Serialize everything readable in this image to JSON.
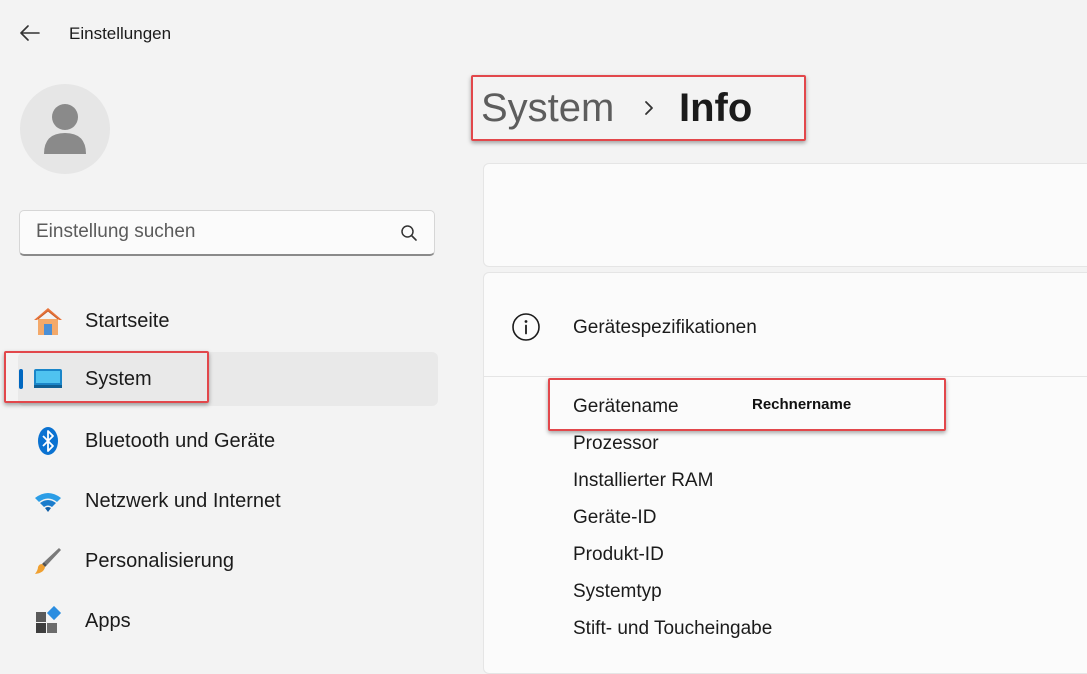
{
  "window": {
    "title": "Einstellungen",
    "back_icon": "back-arrow-icon"
  },
  "avatar": {
    "icon": "user-icon"
  },
  "search": {
    "placeholder": "Einstellung suchen",
    "value": "",
    "icon": "search-icon"
  },
  "sidebar": {
    "items": [
      {
        "label": "Startseite",
        "icon": "home-icon",
        "selected": false
      },
      {
        "label": "System",
        "icon": "system-display-icon",
        "selected": true
      },
      {
        "label": "Bluetooth und Geräte",
        "icon": "bluetooth-icon",
        "selected": false
      },
      {
        "label": "Netzwerk und Internet",
        "icon": "wifi-icon",
        "selected": false
      },
      {
        "label": "Personalisierung",
        "icon": "paintbrush-icon",
        "selected": false
      },
      {
        "label": "Apps",
        "icon": "apps-icon",
        "selected": false
      }
    ]
  },
  "breadcrumb": {
    "parent": "System",
    "current": "Info",
    "separator_icon": "chevron-right-icon"
  },
  "specs": {
    "title": "Gerätespezifikationen",
    "icon": "info-icon",
    "rows": [
      {
        "label": "Gerätename",
        "value": "Rechnername"
      },
      {
        "label": "Prozessor",
        "value": ""
      },
      {
        "label": "Installierter RAM",
        "value": ""
      },
      {
        "label": "Geräte-ID",
        "value": ""
      },
      {
        "label": "Produkt-ID",
        "value": ""
      },
      {
        "label": "Systemtyp",
        "value": ""
      },
      {
        "label": "Stift- und Toucheingabe",
        "value": ""
      }
    ]
  },
  "colors": {
    "accent": "#0067c0",
    "highlight": "#e2474b",
    "background": "#f3f3f3",
    "card": "#fbfbfb"
  }
}
